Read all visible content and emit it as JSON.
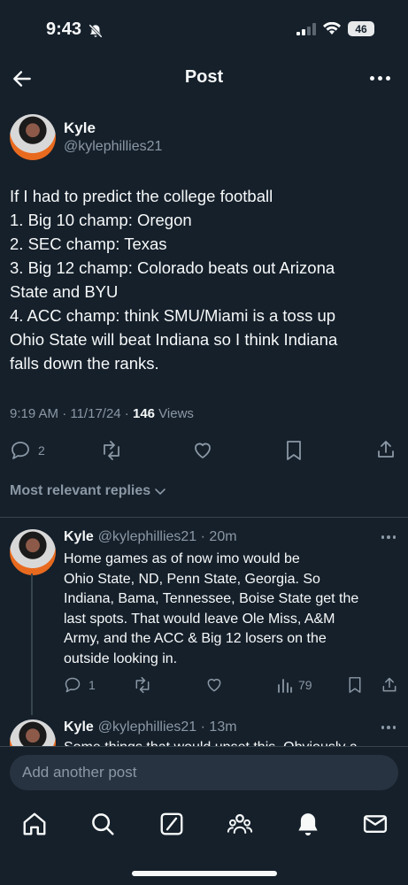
{
  "status_bar": {
    "time": "9:43",
    "battery": "46"
  },
  "header": {
    "title": "Post"
  },
  "post": {
    "author_name": "Kyle",
    "author_handle": "@kylephillies21",
    "lines": [
      "If I had to predict the college football",
      "1. Big 10 champ: Oregon",
      "2. SEC champ: Texas",
      "3. Big 12 champ: Colorado beats out Arizona",
      "State and BYU",
      "4. ACC champ: think SMU/Miami is a toss up",
      "Ohio State will beat Indiana so I think Indiana",
      "falls down the ranks."
    ],
    "timestamp": "9:19 AM · 11/17/24 · ",
    "views_count": "146",
    "views_label": " Views",
    "reply_count": "2"
  },
  "replies_sort": {
    "label": "Most relevant replies"
  },
  "replies": [
    {
      "name": "Kyle",
      "handle_time": "@kylephillies21 · 20m",
      "lines": [
        "Home games as of now imo would be",
        "Ohio State, ND, Penn State, Georgia. So",
        "Indiana, Bama, Tennessee, Boise State get the",
        "last spots. That would leave Ole Miss, A&M",
        "Army, and the ACC & Big 12 losers on the",
        "outside looking in."
      ],
      "reply_count": "1",
      "views": "79"
    },
    {
      "name": "Kyle",
      "handle_time": "@kylephillies21 · 13m",
      "first_line": "Some things that would upset this. Obviously a"
    }
  ],
  "composer": {
    "placeholder": "Add another post"
  },
  "tabs": [
    "home-icon",
    "search-icon",
    "grok-icon",
    "communities-icon",
    "notifications-icon",
    "messages-icon"
  ],
  "colors": {
    "background": "#15202b",
    "text": "#f7f9f9",
    "muted": "#8b98a5",
    "divider": "#38444d"
  }
}
